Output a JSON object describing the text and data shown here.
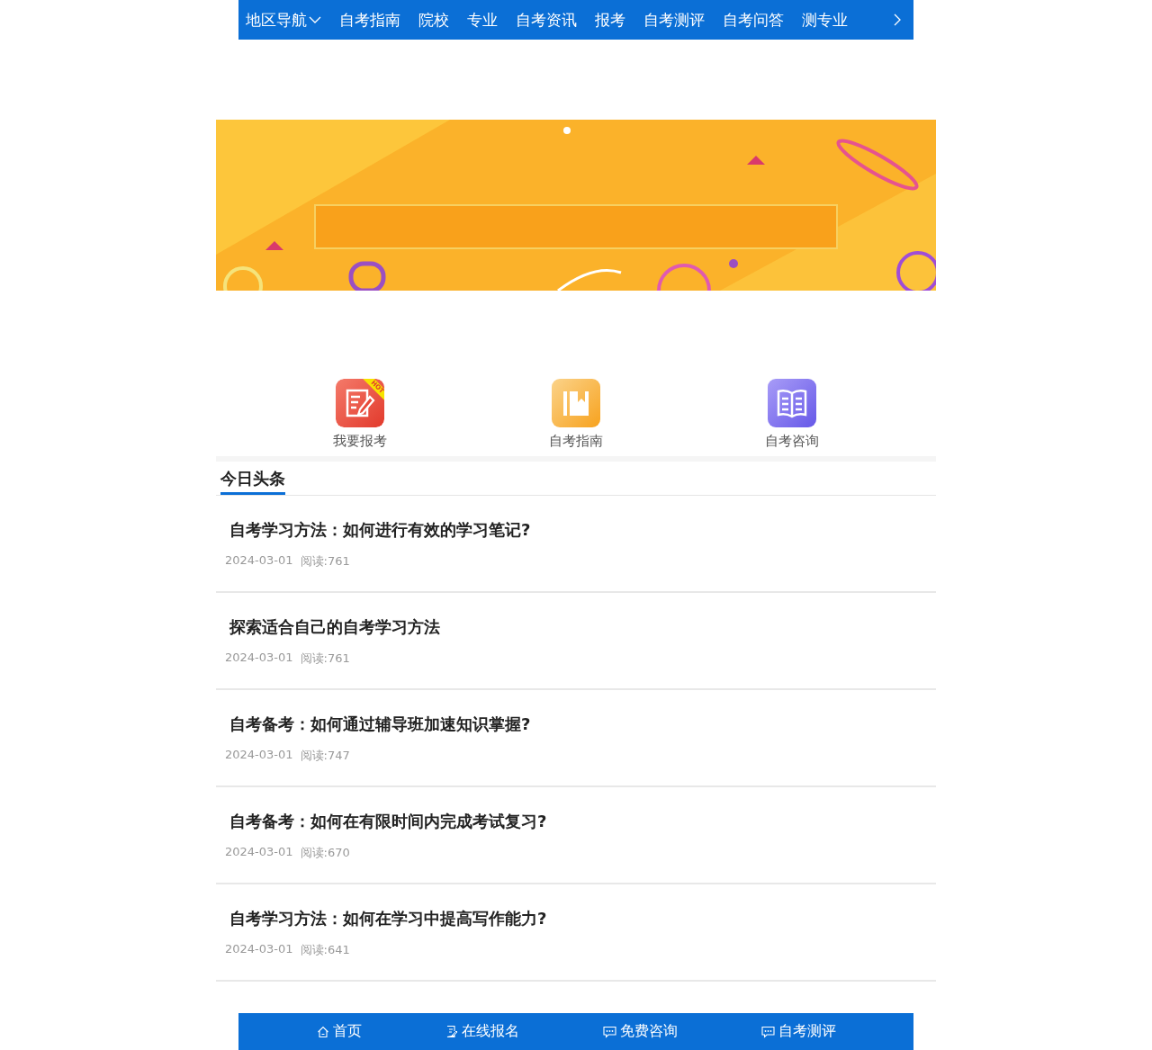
{
  "top_nav": {
    "region_menu": "地区导航",
    "items": [
      "自考指南",
      "院校",
      "专业",
      "自考资讯",
      "报考",
      "自考测评",
      "自考问答",
      "测专业"
    ]
  },
  "shortcuts": [
    {
      "label": "我要报考",
      "kind": "register",
      "badge": "HOT"
    },
    {
      "label": "自考指南",
      "kind": "guide"
    },
    {
      "label": "自考咨询",
      "kind": "consult"
    }
  ],
  "headlines": {
    "title": "今日头条",
    "articles": [
      {
        "title": "自考学习方法：如何进行有效的学习笔记?",
        "date": "2024-03-01",
        "reads": "阅读:761"
      },
      {
        "title": "探索适合自己的自考学习方法",
        "date": "2024-03-01",
        "reads": "阅读:761"
      },
      {
        "title": "自考备考：如何通过辅导班加速知识掌握?",
        "date": "2024-03-01",
        "reads": "阅读:747"
      },
      {
        "title": "自考备考：如何在有限时间内完成考试复习?",
        "date": "2024-03-01",
        "reads": "阅读:670"
      },
      {
        "title": "自考学习方法：如何在学习中提高写作能力?",
        "date": "2024-03-01",
        "reads": "阅读:641"
      }
    ]
  },
  "bottom_bar": [
    {
      "label": "首页",
      "kind": "home"
    },
    {
      "label": "在线报名",
      "kind": "form"
    },
    {
      "label": "免费咨询",
      "kind": "chat"
    },
    {
      "label": "自考测评",
      "kind": "chat"
    }
  ]
}
